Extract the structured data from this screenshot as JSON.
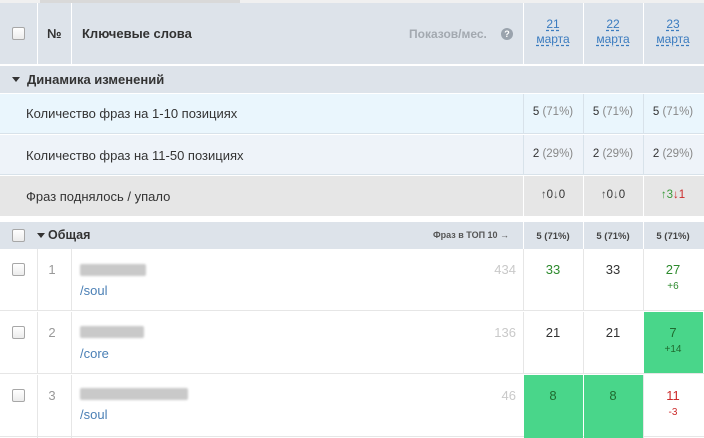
{
  "colors": {
    "header_bg": "#dde3ea",
    "link": "#3a7bbf",
    "highlight": "#49d68a",
    "up": "#3a9a3a",
    "down": "#cc2a2a"
  },
  "header": {
    "num": "№",
    "keywords": "Ключевые слова",
    "shows": "Показов/мес.",
    "help_icon": "?",
    "dates": [
      {
        "day": "21",
        "month": "марта"
      },
      {
        "day": "22",
        "month": "марта"
      },
      {
        "day": "23",
        "month": "марта"
      }
    ]
  },
  "dynamics": {
    "title": "Динамика изменений",
    "rows": [
      {
        "label": "Количество фраз на 1-10 позициях",
        "values": [
          {
            "n": "5",
            "p": "(71%)"
          },
          {
            "n": "5",
            "p": "(71%)"
          },
          {
            "n": "5",
            "p": "(71%)"
          }
        ]
      },
      {
        "label": "Количество фраз на 11-50 позициях",
        "values": [
          {
            "n": "2",
            "p": "(29%)"
          },
          {
            "n": "2",
            "p": "(29%)"
          },
          {
            "n": "2",
            "p": "(29%)"
          }
        ]
      }
    ],
    "movement": {
      "label": "Фраз поднялось / упало",
      "values": [
        {
          "up": "0",
          "down": "0"
        },
        {
          "up": "0",
          "down": "0"
        },
        {
          "up": "3",
          "down": "1"
        }
      ]
    }
  },
  "general": {
    "title": "Общая",
    "top10_label": "Фраз в ТОП 10 →",
    "values": [
      "5 (71%)",
      "5 (71%)",
      "5 (71%)"
    ]
  },
  "rows": [
    {
      "num": "1",
      "path": "/soul",
      "shows": "434",
      "positions": [
        "33",
        "33",
        "27"
      ],
      "delta": "+6"
    },
    {
      "num": "2",
      "path": "/core",
      "shows": "136",
      "positions": [
        "21",
        "21",
        "7"
      ],
      "delta": "+14"
    },
    {
      "num": "3",
      "path": "/soul",
      "shows": "46",
      "positions": [
        "8",
        "8",
        "11"
      ],
      "delta": "-3"
    }
  ]
}
